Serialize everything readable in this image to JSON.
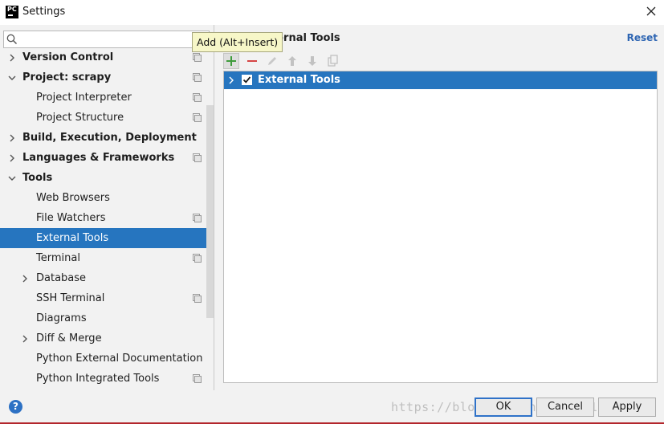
{
  "window": {
    "title": "Settings",
    "app_icon_text": "PC"
  },
  "search": {
    "placeholder": ""
  },
  "tree": [
    {
      "label": "Version Control",
      "bold": true,
      "level": 0,
      "chevron": "right",
      "project_icon": true,
      "selected": false
    },
    {
      "label": "Project: scrapy",
      "bold": true,
      "level": 0,
      "chevron": "down",
      "project_icon": true,
      "selected": false
    },
    {
      "label": "Project Interpreter",
      "bold": false,
      "level": 1,
      "chevron": "",
      "project_icon": true,
      "selected": false
    },
    {
      "label": "Project Structure",
      "bold": false,
      "level": 1,
      "chevron": "",
      "project_icon": true,
      "selected": false
    },
    {
      "label": "Build, Execution, Deployment",
      "bold": true,
      "level": 0,
      "chevron": "right",
      "project_icon": false,
      "selected": false
    },
    {
      "label": "Languages & Frameworks",
      "bold": true,
      "level": 0,
      "chevron": "right",
      "project_icon": true,
      "selected": false
    },
    {
      "label": "Tools",
      "bold": true,
      "level": 0,
      "chevron": "down",
      "project_icon": false,
      "selected": false
    },
    {
      "label": "Web Browsers",
      "bold": false,
      "level": 1,
      "chevron": "",
      "project_icon": false,
      "selected": false
    },
    {
      "label": "File Watchers",
      "bold": false,
      "level": 1,
      "chevron": "",
      "project_icon": true,
      "selected": false
    },
    {
      "label": "External Tools",
      "bold": false,
      "level": 1,
      "chevron": "",
      "project_icon": false,
      "selected": true
    },
    {
      "label": "Terminal",
      "bold": false,
      "level": 1,
      "chevron": "",
      "project_icon": true,
      "selected": false
    },
    {
      "label": "Database",
      "bold": false,
      "level": 1,
      "chevron": "right",
      "project_icon": false,
      "selected": false
    },
    {
      "label": "SSH Terminal",
      "bold": false,
      "level": 1,
      "chevron": "",
      "project_icon": true,
      "selected": false
    },
    {
      "label": "Diagrams",
      "bold": false,
      "level": 1,
      "chevron": "",
      "project_icon": false,
      "selected": false
    },
    {
      "label": "Diff & Merge",
      "bold": false,
      "level": 1,
      "chevron": "right",
      "project_icon": false,
      "selected": false
    },
    {
      "label": "Python External Documentation",
      "bold": false,
      "level": 1,
      "chevron": "",
      "project_icon": false,
      "selected": false
    },
    {
      "label": "Python Integrated Tools",
      "bold": false,
      "level": 1,
      "chevron": "",
      "project_icon": true,
      "selected": false
    }
  ],
  "right": {
    "section_title": "ternal Tools",
    "reset_label": "Reset",
    "toolbar": {
      "add": "add-icon",
      "remove": "remove-icon",
      "edit": "edit-icon",
      "move_up": "arrow-up-icon",
      "move_down": "arrow-down-icon",
      "copy": "copy-icon"
    },
    "tooltip": "Add (Alt+Insert)",
    "list": [
      {
        "label": "External Tools",
        "checked": true,
        "selected": true
      }
    ]
  },
  "buttons": {
    "ok": "OK",
    "cancel": "Cancel",
    "apply": "Apply"
  },
  "watermark": "https://blog.csdn.net/qq_4164625",
  "colors": {
    "selection": "#2675bf",
    "link": "#2f66b3",
    "add_green": "#3e9b3c",
    "remove_red": "#d64545",
    "help_blue": "#2d71c4"
  }
}
